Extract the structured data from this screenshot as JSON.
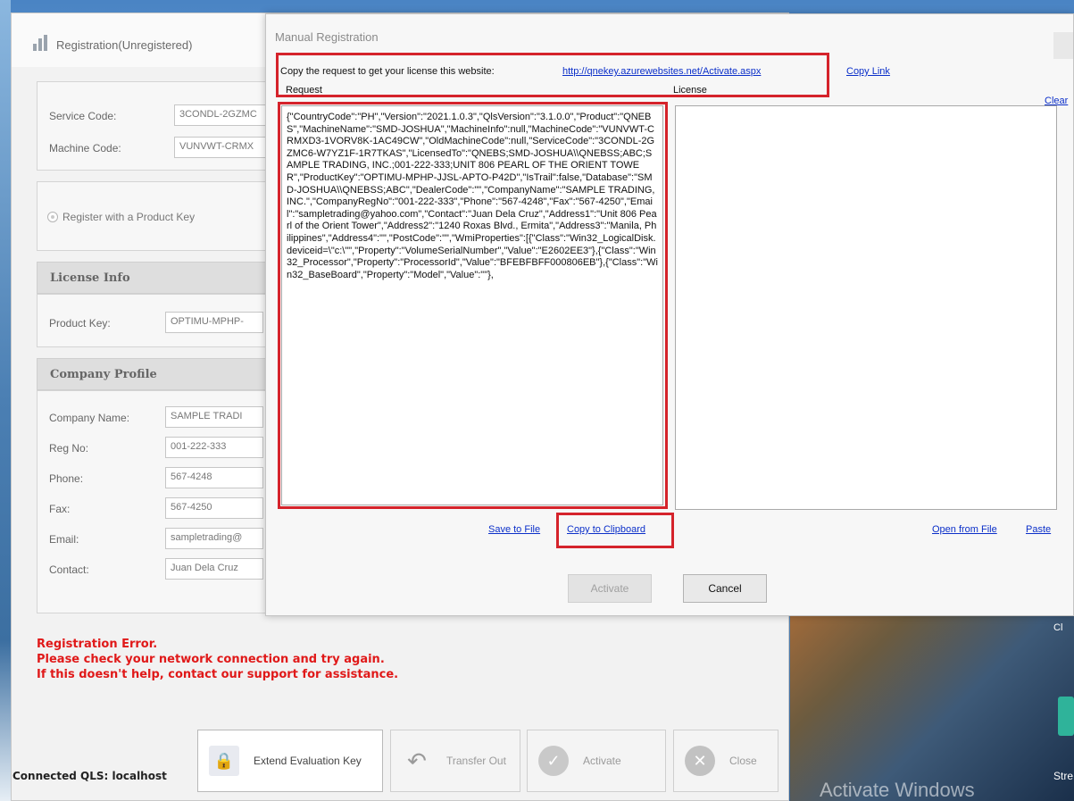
{
  "registration_window": {
    "title": "Registration(Unregistered)",
    "service_code_label": "Service Code:",
    "service_code_value": "3CONDL-2GZMC",
    "machine_code_label": "Machine Code:",
    "machine_code_value": "VUNVWT-CRMX",
    "register_option_label": "Register with a Product Key",
    "license_info_heading": "License Info",
    "product_key_label": "Product Key:",
    "product_key_value": "OPTIMU-MPHP-",
    "company_profile_heading": "Company Profile",
    "company_fields": [
      {
        "label": "Company Name:",
        "value": "SAMPLE TRADI"
      },
      {
        "label": "Reg No:",
        "value": "001-222-333"
      },
      {
        "label": "Phone:",
        "value": "567-4248"
      },
      {
        "label": "Fax:",
        "value": "567-4250"
      },
      {
        "label": "Email:",
        "value": "sampletrading@"
      },
      {
        "label": "Contact:",
        "value": "Juan Dela Cruz"
      }
    ],
    "error_lines": [
      "Registration Error.",
      "Please check your network connection and try again.",
      "If this doesn't help, contact our support for assistance."
    ],
    "buttons": {
      "extend": "Extend Evaluation Key",
      "transfer": "Transfer Out",
      "activate": "Activate",
      "close": "Close"
    },
    "status": "Connected QLS: localhost"
  },
  "manual_dialog": {
    "title": "Manual Registration",
    "copy_request_text": "Copy the request to get your license this website:",
    "activation_url": "http://qnekey.azurewebsites.net/Activate.aspx",
    "copy_link": "Copy Link",
    "request_heading": "Request",
    "license_heading": "License",
    "clear_link": "Clear",
    "request_text": "{\"CountryCode\":\"PH\",\"Version\":\"2021.1.0.3\",\"QlsVersion\":\"3.1.0.0\",\"Product\":\"QNEBS\",\"MachineName\":\"SMD-JOSHUA\",\"MachineInfo\":null,\"MachineCode\":\"VUNVWT-CRMXD3-1VORV8K-1AC49CW\",\"OldMachineCode\":null,\"ServiceCode\":\"3CONDL-2GZMC6-W7YZ1F-1R7TKAS\",\"LicensedTo\":\"QNEBS;SMD-JOSHUA\\\\QNEBSS;ABC;SAMPLE TRADING, INC.;001-222-333;UNIT 806 PEARL OF THE ORIENT TOWER\",\"ProductKey\":\"OPTIMU-MPHP-JJSL-APTO-P42D\",\"IsTrail\":false,\"Database\":\"SMD-JOSHUA\\\\QNEBSS;ABC\",\"DealerCode\":\"\",\"CompanyName\":\"SAMPLE TRADING, INC.\",\"CompanyRegNo\":\"001-222-333\",\"Phone\":\"567-4248\",\"Fax\":\"567-4250\",\"Email\":\"sampletrading@yahoo.com\",\"Contact\":\"Juan Dela Cruz\",\"Address1\":\"Unit 806 Pearl of the Orient Tower\",\"Address2\":\"1240 Roxas Blvd., Ermita\",\"Address3\":\"Manila, Philippines\",\"Address4\":\"\",\"PostCode\":\"\",\"WmiProperties\":[{\"Class\":\"Win32_LogicalDisk.deviceid=\\\"c:\\\"\",\"Property\":\"VolumeSerialNumber\",\"Value\":\"E2602EE3\"},{\"Class\":\"Win32_Processor\",\"Property\":\"ProcessorId\",\"Value\":\"BFEBFBFF000806EB\"},{\"Class\":\"Win32_BaseBoard\",\"Property\":\"Model\",\"Value\":\"\"},",
    "license_text": "",
    "save_to_file": "Save to File",
    "copy_to_clipboard": "Copy to Clipboard",
    "open_from_file": "Open from File",
    "paste": "Paste",
    "activate_button": "Activate",
    "cancel_button": "Cancel"
  },
  "desktop": {
    "watermark": "Activate Windows",
    "icon_label": "Stre",
    "corner_label": "Cl"
  }
}
